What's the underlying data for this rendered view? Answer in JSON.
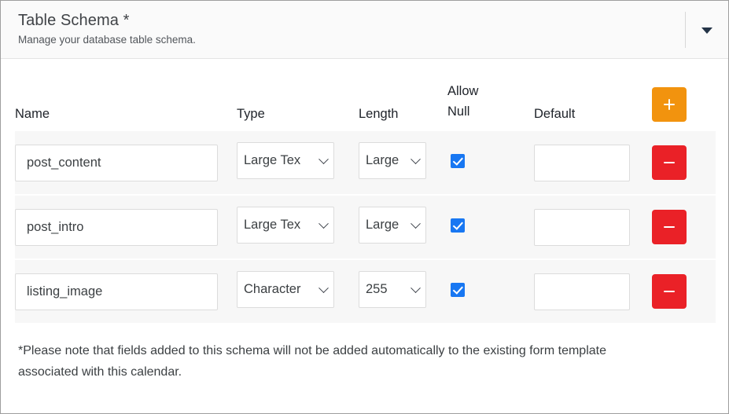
{
  "panel": {
    "title": "Table Schema *",
    "subtitle": "Manage your database table schema.",
    "collapse_icon": "chevron-down-icon"
  },
  "table": {
    "headers": {
      "name": "Name",
      "type": "Type",
      "length": "Length",
      "allow_null_line1": "Allow",
      "allow_null_line2": "Null",
      "default": "Default"
    },
    "add_button_label": "+",
    "remove_button_label": "−",
    "rows": [
      {
        "name": "post_content",
        "type": "Large Tex",
        "length": "Large",
        "allow_null": true,
        "default": ""
      },
      {
        "name": "post_intro",
        "type": "Large Tex",
        "length": "Large",
        "allow_null": true,
        "default": ""
      },
      {
        "name": "listing_image",
        "type": "Character",
        "length": "255",
        "allow_null": true,
        "default": ""
      }
    ]
  },
  "footer": {
    "note": "*Please note that fields added to this schema will not be added automatically to the existing form template associated with this calendar."
  },
  "colors": {
    "add_button": "#f2930e",
    "remove_button": "#ea2127",
    "checkbox": "#1877f2",
    "row_background": "#f7f7f7",
    "header_background": "#fafafa"
  }
}
